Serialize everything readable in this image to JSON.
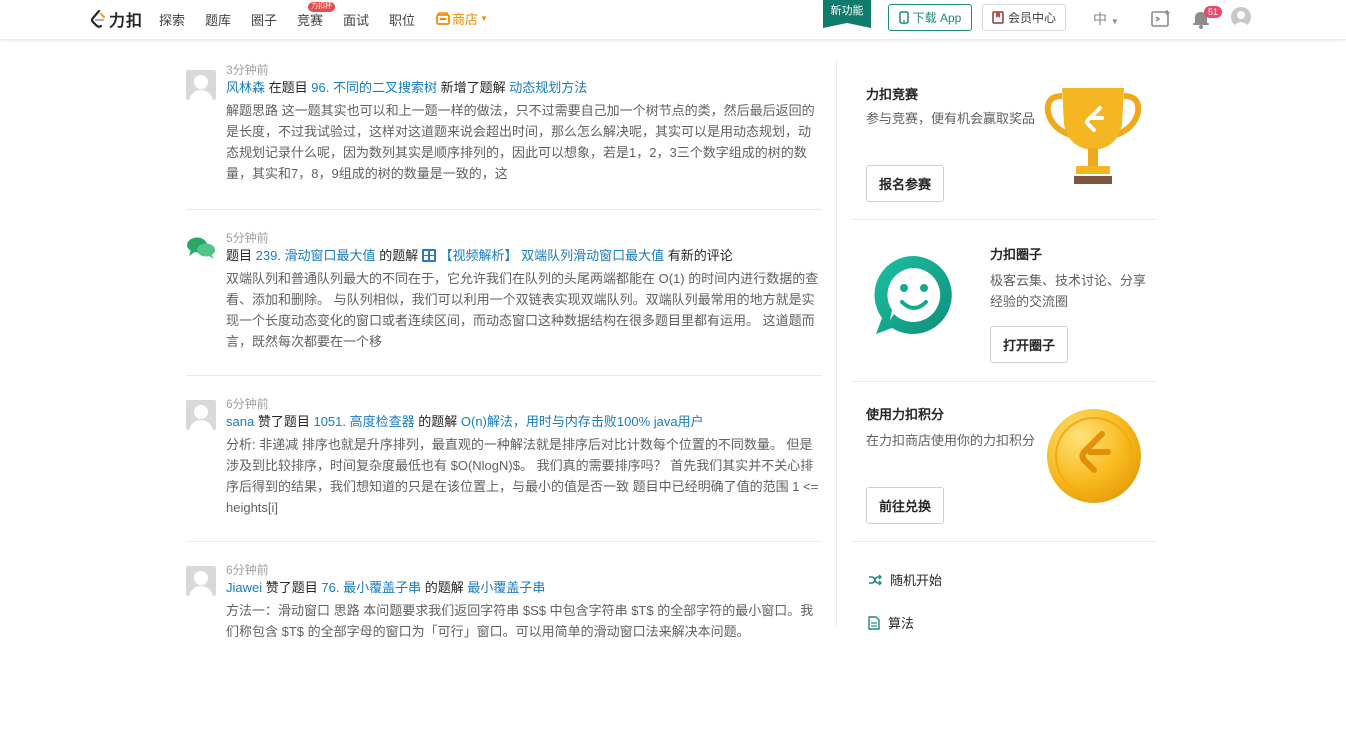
{
  "nav": {
    "logo_text": "力扣",
    "items": [
      "探索",
      "题库",
      "圈子",
      "竞赛",
      "面试",
      "职位"
    ],
    "contest_badge": "力扣杯",
    "store_label": "商店",
    "new_feature": "新功能",
    "download_app": "下载 App",
    "vip_center": "会员中心",
    "lang": "中",
    "notif_count": "51",
    "accent": "#0f7b6c"
  },
  "feed": [
    {
      "time": "3分钟前",
      "user": "风林森",
      "action1": "在题目",
      "problem": "96. 不同的二叉搜索树",
      "action2": "新增了题解",
      "solution": "动态规划方法",
      "body": "解题思路 这一题其实也可以和上一题一样的做法，只不过需要自己加一个树节点的类，然后最后返回的是长度，不过我试验过，这样对这道题来说会超出时间，那么怎么解决呢，其实可以是用动态规划，动态规划记录什么呢，因为数列其实是顺序排列的，因此可以想象，若是1，2，3三个数字组成的树的数量，其实和7，8，9组成的树的数量是一致的，这"
    },
    {
      "time": "5分钟前",
      "prefix": "题目",
      "problem": "239. 滑动窗口最大值",
      "action1": "的题解",
      "solution": "【视频解析】 双端队列滑动窗口最大值",
      "action2": "有新的评论",
      "body": "双端队列和普通队列最大的不同在于，它允许我们在队列的头尾两端都能在 O(1) 的时间内进行数据的查看、添加和删除。 与队列相似，我们可以利用一个双链表实现双端队列。双端队列最常用的地方就是实现一个长度动态变化的窗口或者连续区间，而动态窗口这种数据结构在很多题目里都有运用。 这道题而言，既然每次都要在一个移"
    },
    {
      "time": "6分钟前",
      "user": "sana",
      "action1": "赞了题目",
      "problem": "1051. 高度检查器",
      "action2": "的题解",
      "solution": "O(n)解法，用时与内存击败100% java用户",
      "body": "分析: 非递减 排序也就是升序排列，最直观的一种解法就是排序后对比计数每个位置的不同数量。 但是涉及到比较排序，时间复杂度最低也有 $O(NlogN)$。 我们真的需要排序吗？ 首先我们其实并不关心排序后得到的结果，我们想知道的只是在该位置上，与最小的值是否一致 题目中已经明确了值的范围 1 <= heights[i]"
    },
    {
      "time": "6分钟前",
      "user": "Jiawei",
      "action1": "赞了题目",
      "problem": "76. 最小覆盖子串",
      "action2": "的题解",
      "solution": "最小覆盖子串",
      "body": "方法一：滑动窗口 思路 本问题要求我们返回字符串 $S$ 中包含字符串 $T$ 的全部字符的最小窗口。我们称包含 $T$ 的全部字母的窗口为「可行」窗口。可以用简单的滑动窗口法来解决本问题。"
    }
  ],
  "sidebar": {
    "contest": {
      "title": "力扣竞赛",
      "desc": "参与竞赛，便有机会赢取奖品",
      "button": "报名参赛"
    },
    "circle": {
      "title": "力扣圈子",
      "desc": "极客云集、技术讨论、分享经验的交流圈",
      "button": "打开圈子"
    },
    "points": {
      "title": "使用力扣积分",
      "desc": "在力扣商店使用你的力扣积分",
      "button": "前往兑换"
    },
    "links": [
      "随机开始",
      "算法"
    ]
  }
}
